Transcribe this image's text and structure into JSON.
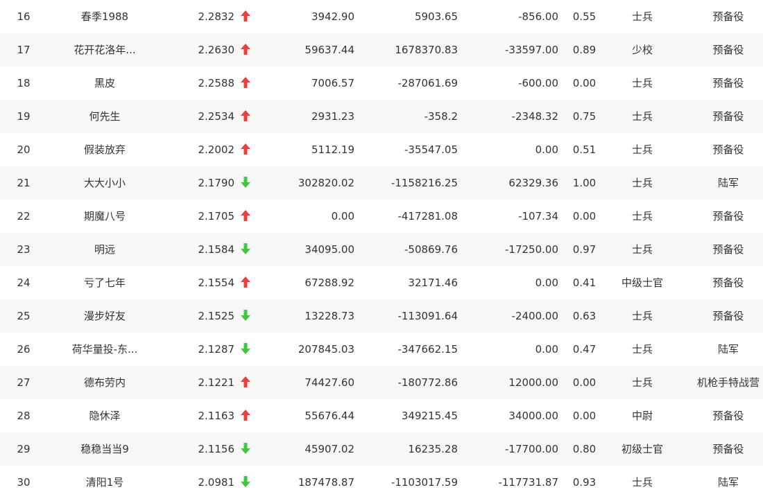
{
  "colors": {
    "up": "#e6413b",
    "down": "#3ec645",
    "text": "#333333",
    "row_alt_bg": "#f7f7f7"
  },
  "rows": [
    {
      "rank": "16",
      "name": "春季1988",
      "score": "2.2832",
      "trend": "up",
      "trend_icon": "arrow-up-icon",
      "v1": "3942.90",
      "v2": "5903.65",
      "v3": "-856.00",
      "ratio": "0.55",
      "title": "士兵",
      "unit": "预备役"
    },
    {
      "rank": "17",
      "name": "花开花洛年...",
      "score": "2.2630",
      "trend": "up",
      "trend_icon": "arrow-up-icon",
      "v1": "59637.44",
      "v2": "1678370.83",
      "v3": "-33597.00",
      "ratio": "0.89",
      "title": "少校",
      "unit": "预备役"
    },
    {
      "rank": "18",
      "name": "黑皮",
      "score": "2.2588",
      "trend": "up",
      "trend_icon": "arrow-up-icon",
      "v1": "7006.57",
      "v2": "-287061.69",
      "v3": "-600.00",
      "ratio": "0.00",
      "title": "士兵",
      "unit": "预备役"
    },
    {
      "rank": "19",
      "name": "何先生",
      "score": "2.2534",
      "trend": "up",
      "trend_icon": "arrow-up-icon",
      "v1": "2931.23",
      "v2": "-358.2",
      "v3": "-2348.32",
      "ratio": "0.75",
      "title": "士兵",
      "unit": "预备役"
    },
    {
      "rank": "20",
      "name": "假装放弃",
      "score": "2.2002",
      "trend": "up",
      "trend_icon": "arrow-up-icon",
      "v1": "5112.19",
      "v2": "-35547.05",
      "v3": "0.00",
      "ratio": "0.51",
      "title": "士兵",
      "unit": "预备役"
    },
    {
      "rank": "21",
      "name": "大大小小",
      "score": "2.1790",
      "trend": "down",
      "trend_icon": "arrow-down-icon",
      "v1": "302820.02",
      "v2": "-1158216.25",
      "v3": "62329.36",
      "ratio": "1.00",
      "title": "士兵",
      "unit": "陆军"
    },
    {
      "rank": "22",
      "name": "期魔八号",
      "score": "2.1705",
      "trend": "up",
      "trend_icon": "arrow-up-icon",
      "v1": "0.00",
      "v2": "-417281.08",
      "v3": "-107.34",
      "ratio": "0.00",
      "title": "士兵",
      "unit": "预备役"
    },
    {
      "rank": "23",
      "name": "明远",
      "score": "2.1584",
      "trend": "down",
      "trend_icon": "arrow-down-icon",
      "v1": "34095.00",
      "v2": "-50869.76",
      "v3": "-17250.00",
      "ratio": "0.97",
      "title": "士兵",
      "unit": "预备役"
    },
    {
      "rank": "24",
      "name": "亏了七年",
      "score": "2.1554",
      "trend": "up",
      "trend_icon": "arrow-up-icon",
      "v1": "67288.92",
      "v2": "32171.46",
      "v3": "0.00",
      "ratio": "0.41",
      "title": "中级士官",
      "unit": "预备役"
    },
    {
      "rank": "25",
      "name": "漫步好友",
      "score": "2.1525",
      "trend": "down",
      "trend_icon": "arrow-down-icon",
      "v1": "13228.73",
      "v2": "-113091.64",
      "v3": "-2400.00",
      "ratio": "0.63",
      "title": "士兵",
      "unit": "预备役"
    },
    {
      "rank": "26",
      "name": "荷华量投-东...",
      "score": "2.1287",
      "trend": "down",
      "trend_icon": "arrow-down-icon",
      "v1": "207845.03",
      "v2": "-347662.15",
      "v3": "0.00",
      "ratio": "0.47",
      "title": "士兵",
      "unit": "陆军"
    },
    {
      "rank": "27",
      "name": "德布劳内",
      "score": "2.1221",
      "trend": "up",
      "trend_icon": "arrow-up-icon",
      "v1": "74427.60",
      "v2": "-180772.86",
      "v3": "12000.00",
      "ratio": "0.00",
      "title": "士兵",
      "unit": "机枪手特战营"
    },
    {
      "rank": "28",
      "name": "隐休泽",
      "score": "2.1163",
      "trend": "up",
      "trend_icon": "arrow-up-icon",
      "v1": "55676.44",
      "v2": "349215.45",
      "v3": "34000.00",
      "ratio": "0.00",
      "title": "中尉",
      "unit": "预备役"
    },
    {
      "rank": "29",
      "name": "稳稳当当9",
      "score": "2.1156",
      "trend": "down",
      "trend_icon": "arrow-down-icon",
      "v1": "45907.02",
      "v2": "16235.28",
      "v3": "-17700.00",
      "ratio": "0.80",
      "title": "初级士官",
      "unit": "预备役"
    },
    {
      "rank": "30",
      "name": "清阳1号",
      "score": "2.0981",
      "trend": "down",
      "trend_icon": "arrow-down-icon",
      "v1": "187478.87",
      "v2": "-1103017.59",
      "v3": "-117731.87",
      "ratio": "0.93",
      "title": "士兵",
      "unit": "陆军"
    }
  ]
}
